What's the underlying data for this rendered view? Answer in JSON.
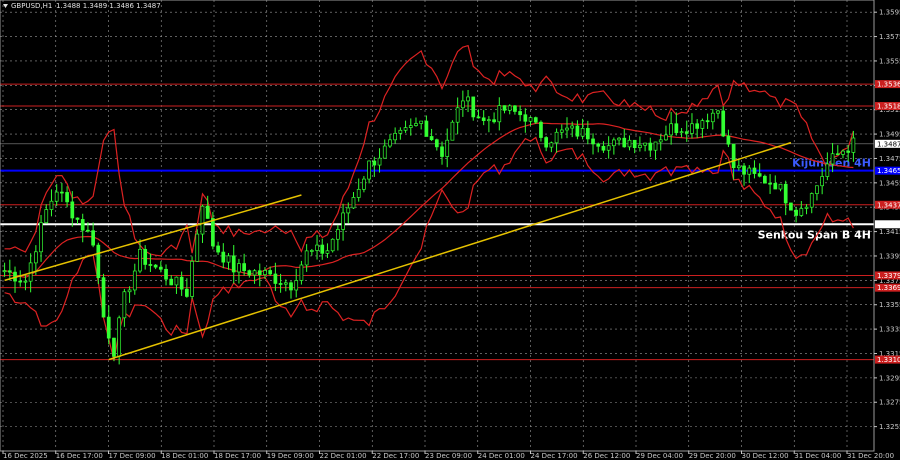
{
  "header": {
    "symbol": "GBPUSD,H1",
    "quotes": "1.3488 1.3489 1.3486 1.3487"
  },
  "colors": {
    "background": "#000000",
    "grid": "#9a9a9a",
    "candle_up": "#33ff33",
    "candle_down": "#33ff33",
    "level_red": "#cc1f1f",
    "kijun": "#0000ff",
    "senkou": "#ffffff",
    "trend": "#e6c200",
    "channel": "#dd2222"
  },
  "chart_data": {
    "type": "candlestick",
    "ylim": [
      1.3235,
      1.3605
    ],
    "y_ticks": [
      "1.3595",
      "1.3575",
      "1.3555",
      "1.3535",
      "1.3515",
      "1.3495",
      "1.3475",
      "1.3455",
      "1.3435",
      "1.3415",
      "1.3395",
      "1.3375",
      "1.3355",
      "1.3335",
      "1.3315",
      "1.3295",
      "1.3275",
      "1.3255"
    ],
    "x_ticks": [
      "16 Dec 2025",
      "16 Dec 17:00",
      "17 Dec 09:00",
      "18 Dec 01:00",
      "18 Dec 17:00",
      "19 Dec 09:00",
      "22 Dec 01:00",
      "22 Dec 17:00",
      "23 Dec 09:00",
      "24 Dec 01:00",
      "24 Dec 17:00",
      "26 Dec 12:00",
      "29 Dec 04:00",
      "29 Dec 20:00",
      "30 Dec 12:00",
      "31 Dec 04:00",
      "31 Dec 20:00"
    ],
    "bars": 164,
    "close_series": [
      {
        "bar": 0,
        "price": 1.3383
      },
      {
        "bar": 4,
        "price": 1.3375
      },
      {
        "bar": 8,
        "price": 1.3432
      },
      {
        "bar": 10,
        "price": 1.345
      },
      {
        "bar": 14,
        "price": 1.3425
      },
      {
        "bar": 17,
        "price": 1.3408
      },
      {
        "bar": 19,
        "price": 1.3345
      },
      {
        "bar": 21,
        "price": 1.3318
      },
      {
        "bar": 23,
        "price": 1.336
      },
      {
        "bar": 26,
        "price": 1.3395
      },
      {
        "bar": 30,
        "price": 1.3382
      },
      {
        "bar": 35,
        "price": 1.3365
      },
      {
        "bar": 38,
        "price": 1.344
      },
      {
        "bar": 40,
        "price": 1.3405
      },
      {
        "bar": 44,
        "price": 1.3385
      },
      {
        "bar": 50,
        "price": 1.338
      },
      {
        "bar": 55,
        "price": 1.3372
      },
      {
        "bar": 58,
        "price": 1.3397
      },
      {
        "bar": 62,
        "price": 1.34
      },
      {
        "bar": 66,
        "price": 1.3435
      },
      {
        "bar": 70,
        "price": 1.347
      },
      {
        "bar": 75,
        "price": 1.349
      },
      {
        "bar": 80,
        "price": 1.3505
      },
      {
        "bar": 84,
        "price": 1.348
      },
      {
        "bar": 88,
        "price": 1.3525
      },
      {
        "bar": 92,
        "price": 1.3505
      },
      {
        "bar": 96,
        "price": 1.3515
      },
      {
        "bar": 100,
        "price": 1.351
      },
      {
        "bar": 104,
        "price": 1.349
      },
      {
        "bar": 108,
        "price": 1.3498
      },
      {
        "bar": 112,
        "price": 1.3495
      },
      {
        "bar": 116,
        "price": 1.3485
      },
      {
        "bar": 120,
        "price": 1.349
      },
      {
        "bar": 124,
        "price": 1.3487
      },
      {
        "bar": 128,
        "price": 1.35
      },
      {
        "bar": 132,
        "price": 1.3502
      },
      {
        "bar": 137,
        "price": 1.3515
      },
      {
        "bar": 140,
        "price": 1.3468
      },
      {
        "bar": 144,
        "price": 1.346
      },
      {
        "bar": 148,
        "price": 1.3455
      },
      {
        "bar": 152,
        "price": 1.3432
      },
      {
        "bar": 155,
        "price": 1.3445
      },
      {
        "bar": 158,
        "price": 1.347
      },
      {
        "bar": 161,
        "price": 1.3482
      },
      {
        "bar": 163,
        "price": 1.3487
      }
    ],
    "levels": [
      {
        "name": "resistance-1",
        "price": 1.3536,
        "label": "1.3536",
        "kind": "red"
      },
      {
        "name": "resistance-2",
        "price": 1.3518,
        "label": "1.3518",
        "kind": "red"
      },
      {
        "name": "kijun-sen",
        "price": 1.3465,
        "label": "1.3465",
        "kind": "kijun",
        "text": "Kijun-sen 4H"
      },
      {
        "name": "support-1",
        "price": 1.3437,
        "label": "1.3437",
        "kind": "red"
      },
      {
        "name": "senkou-span-b",
        "price": 1.3421,
        "label": "1.3421",
        "kind": "senkou",
        "text": "Senkou Span B 4H"
      },
      {
        "name": "support-2",
        "price": 1.3379,
        "label": "1.3379",
        "kind": "red"
      },
      {
        "name": "support-3",
        "price": 1.3369,
        "label": "1.3369",
        "kind": "red"
      },
      {
        "name": "support-4",
        "price": 1.331,
        "label": "1.3310",
        "kind": "red"
      }
    ],
    "current_price": {
      "price": 1.3487,
      "label": "1.3487"
    },
    "trend_lines": [
      {
        "name": "trendline-upper",
        "from": {
          "bar": 0,
          "price": 1.3375
        },
        "to": {
          "bar": 57,
          "price": 1.3445
        }
      },
      {
        "name": "trendline-middle",
        "from": {
          "bar": 20,
          "price": 1.331
        },
        "to": {
          "bar": 151,
          "price": 1.3488
        }
      }
    ]
  }
}
